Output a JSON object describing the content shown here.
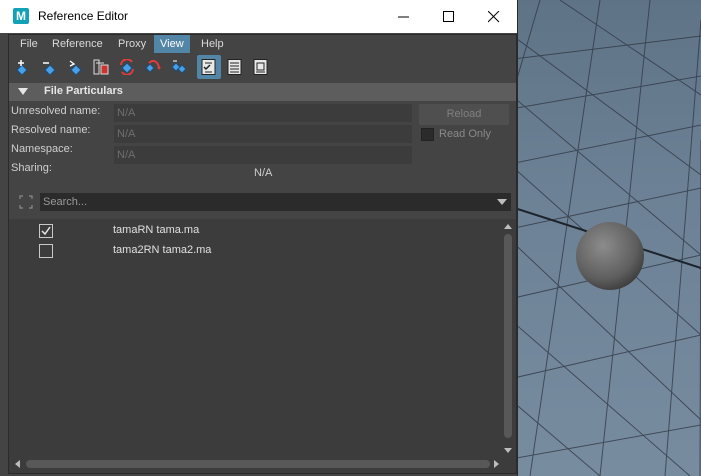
{
  "window": {
    "title": "Reference Editor",
    "app_icon": "M"
  },
  "menus": [
    "File",
    "Reference",
    "Proxy",
    "View",
    "Help"
  ],
  "active_menu": "View",
  "toolbar_icons": [
    "load-reference-icon",
    "unload-reference-icon",
    "reload-reference-icon",
    "import-objects-icon",
    "refresh-reference-icon",
    "remove-reference-icon",
    "duplicate-reference-icon",
    "list-checked-icon",
    "list-view-icon",
    "file-list-icon"
  ],
  "file_particulars": {
    "title": "File Particulars",
    "unresolved_label": "Unresolved name:",
    "unresolved_value": "N/A",
    "resolved_label": "Resolved name:",
    "resolved_value": "N/A",
    "namespace_label": "Namespace:",
    "namespace_value": "N/A",
    "sharing_label": "Sharing:",
    "sharing_value": "N/A",
    "reload_label": "Reload",
    "read_only_label": "Read Only"
  },
  "search": {
    "placeholder": "Search..."
  },
  "references": [
    {
      "label": "tamaRN tama.ma",
      "checked": true
    },
    {
      "label": "tama2RN tama2.ma",
      "checked": false
    }
  ],
  "colors": {
    "accent": "#5285a6",
    "panel_bg": "#444444",
    "list_bg": "#3c3c3c"
  }
}
